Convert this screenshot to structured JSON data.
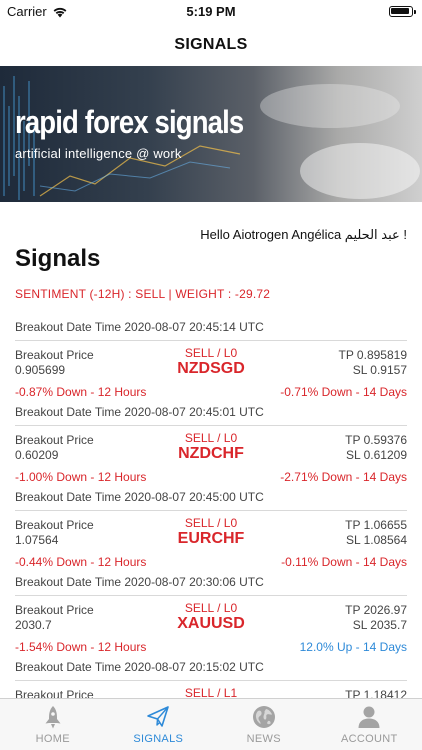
{
  "status_bar": {
    "carrier": "Carrier",
    "time": "5:19 PM"
  },
  "nav": {
    "title": "SIGNALS"
  },
  "banner": {
    "title": "rapid forex signals",
    "subtitle": "artificial intelligence @ work"
  },
  "greeting": "Hello Aiotrogen Angélica عبد الحليم !",
  "section_title": "Signals",
  "sentiment": "SENTIMENT (-12H) : SELL    |    WEIGHT : -29.72",
  "signals": [
    {
      "breakout_datetime": "Breakout Date Time 2020-08-07 20:45:14 UTC",
      "price_label": "Breakout Price",
      "price": "0.905699",
      "direction": "SELL / L0",
      "pair": "NZDSGD",
      "tp": "TP 0.895819",
      "sl": "SL 0.9157",
      "short_change": "-0.87% Down  - 12 Hours",
      "long_change": "-0.71% Down  - 14 Days",
      "long_trend": "down"
    },
    {
      "breakout_datetime": "Breakout Date Time 2020-08-07 20:45:01 UTC",
      "price_label": "Breakout Price",
      "price": "0.60209",
      "direction": "SELL / L0",
      "pair": "NZDCHF",
      "tp": "TP 0.59376",
      "sl": "SL 0.61209",
      "short_change": "-1.00% Down  - 12 Hours",
      "long_change": "-2.71% Down  - 14 Days",
      "long_trend": "down"
    },
    {
      "breakout_datetime": "Breakout Date Time 2020-08-07 20:45:00 UTC",
      "price_label": "Breakout Price",
      "price": "1.07564",
      "direction": "SELL / L0",
      "pair": "EURCHF",
      "tp": "TP 1.06655",
      "sl": "SL 1.08564",
      "short_change": "-0.44% Down  - 12 Hours",
      "long_change": "-0.11% Down  - 14 Days",
      "long_trend": "down"
    },
    {
      "breakout_datetime": "Breakout Date Time 2020-08-07 20:30:06 UTC",
      "price_label": "Breakout Price",
      "price": "2030.7",
      "direction": "SELL / L0",
      "pair": "XAUUSD",
      "tp": "TP 2026.97",
      "sl": "SL 2035.7",
      "short_change": "-1.54% Down  - 12 Hours",
      "long_change": "12.0% Up  - 14 Days",
      "long_trend": "up"
    },
    {
      "breakout_datetime": "Breakout Date Time 2020-08-07 20:15:02 UTC",
      "price_label": "Breakout Price",
      "price": "",
      "direction": "SELL / L1",
      "pair": "",
      "tp": "TP 1.18412",
      "sl": "",
      "short_change": "",
      "long_change": "",
      "long_trend": "down"
    }
  ],
  "tabs": [
    {
      "label": "HOME",
      "icon": "rocket-icon",
      "active": false
    },
    {
      "label": "SIGNALS",
      "icon": "paper-plane-icon",
      "active": true
    },
    {
      "label": "NEWS",
      "icon": "globe-icon",
      "active": false
    },
    {
      "label": "ACCOUNT",
      "icon": "person-icon",
      "active": false
    }
  ],
  "colors": {
    "sell": "#d9262b",
    "up": "#2e8ad8",
    "active_tab": "#2e8ad8",
    "inactive_tab": "#9a9a9a"
  }
}
